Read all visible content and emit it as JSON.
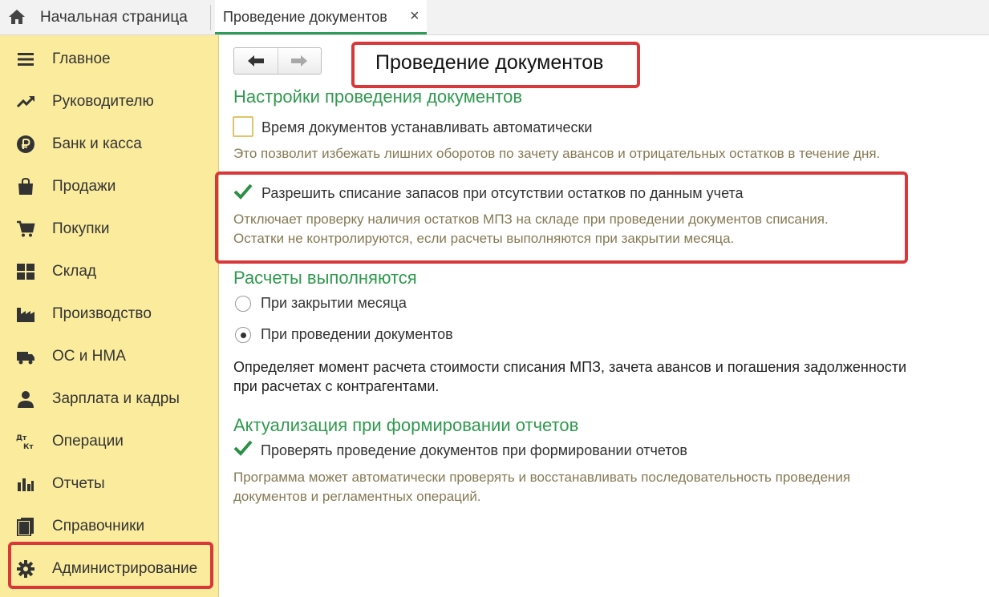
{
  "tabs": {
    "home_label": "Начальная страница",
    "active_label": "Проведение документов",
    "close_glyph": "×"
  },
  "sidebar": {
    "items": [
      {
        "label": "Главное",
        "icon": "menu-icon"
      },
      {
        "label": "Руководителю",
        "icon": "trend-icon"
      },
      {
        "label": "Банк и касса",
        "icon": "ruble-icon"
      },
      {
        "label": "Продажи",
        "icon": "bag-icon"
      },
      {
        "label": "Покупки",
        "icon": "cart-icon"
      },
      {
        "label": "Склад",
        "icon": "warehouse-icon"
      },
      {
        "label": "Производство",
        "icon": "factory-icon"
      },
      {
        "label": "ОС и НМА",
        "icon": "truck-icon"
      },
      {
        "label": "Зарплата и кадры",
        "icon": "person-icon"
      },
      {
        "label": "Операции",
        "icon": "dt-kt-icon"
      },
      {
        "label": "Отчеты",
        "icon": "bar-chart-icon"
      },
      {
        "label": "Справочники",
        "icon": "books-icon"
      },
      {
        "label": "Администрирование",
        "icon": "gear-icon"
      }
    ],
    "dt_label": "Дт",
    "kt_label": "Кт"
  },
  "main": {
    "title": "Проведение документов",
    "section1": {
      "title": "Настройки проведения документов",
      "auto_time_label": "Время документов устанавливать автоматически",
      "auto_time_checked": false,
      "auto_time_hint": "Это позволит избежать лишних оборотов по зачету авансов и отрицательных остатков в течение дня.",
      "allow_label": "Разрешить списание запасов при отсутствии остатков по данным учета",
      "allow_checked": true,
      "allow_hint_1": "Отключает проверку наличия остатков МПЗ на складе при проведении документов списания.",
      "allow_hint_2": "Остатки не контролируются, если расчеты выполняются при закрытии месяца."
    },
    "section2": {
      "title": "Расчеты выполняются",
      "option1": "При закрытии месяца",
      "option2": "При проведении документов",
      "selected": "При проведении документов",
      "desc_1": "Определяет момент расчета стоимости списания МПЗ, зачета авансов и погашения задолженности",
      "desc_2": "при расчетах с контрагентами."
    },
    "section3": {
      "title": "Актуализация при формировании отчетов",
      "check_label": "Проверять проведение документов при формировании отчетов",
      "check_checked": true,
      "hint_1": "Программа может автоматически проверять и восстанавливать последовательность проведения",
      "hint_2": "документов и регламентных операций."
    }
  },
  "colors": {
    "sidebar_bg": "#fbec9d",
    "section_green": "#2f9a4e",
    "highlight_red": "#d9383a",
    "hint_text": "#857a55"
  }
}
